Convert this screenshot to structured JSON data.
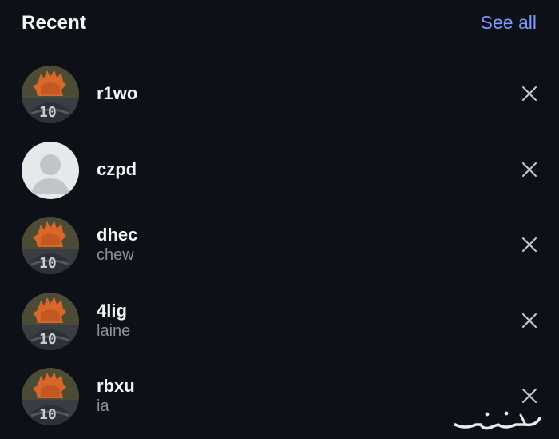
{
  "header": {
    "title": "Recent",
    "see_all_label": "See all"
  },
  "colors": {
    "background": "#0d1016",
    "accent": "#7e9cff",
    "primary_text": "#f4f5f7",
    "secondary_text": "#8b9099"
  },
  "recent_items": [
    {
      "username": "r1wo",
      "subtitle": "",
      "avatar": "profile-photo",
      "remove_icon": "close-icon"
    },
    {
      "username": "czpd",
      "subtitle": "",
      "avatar": "default-avatar",
      "remove_icon": "close-icon"
    },
    {
      "username": "dhec",
      "subtitle": "chew",
      "avatar": "profile-photo",
      "remove_icon": "close-icon"
    },
    {
      "username": "4lig",
      "subtitle": "laine",
      "avatar": "profile-photo",
      "remove_icon": "close-icon"
    },
    {
      "username": "rbxu",
      "subtitle": "ia",
      "avatar": "profile-photo",
      "remove_icon": "close-icon"
    }
  ],
  "watermark": {
    "text": "حراج"
  }
}
